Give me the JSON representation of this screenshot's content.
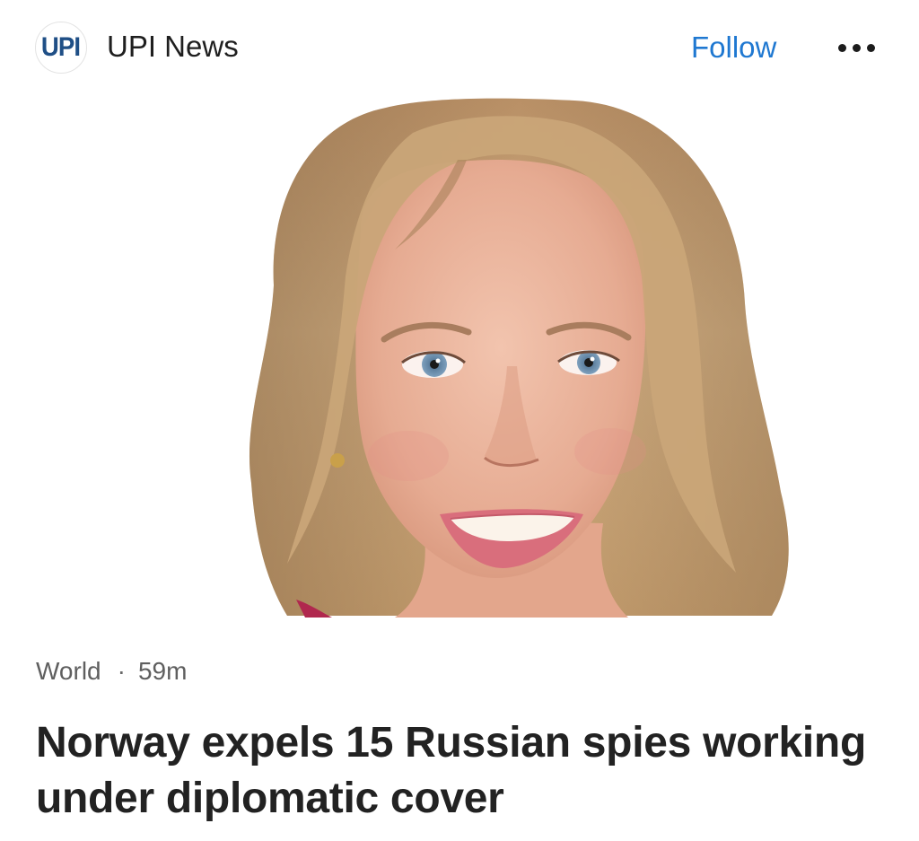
{
  "publisher": {
    "logo_text": "UPI",
    "name": "UPI News",
    "follow_label": "Follow",
    "more_icon": "more-horizontal-icon",
    "brand_color": "#1f4f86",
    "accent_color": "#1f78d1"
  },
  "article": {
    "category": "World",
    "separator": "·",
    "time_ago": "59m",
    "headline": "Norway expels 15 Russian spies working under diplomatic cover"
  }
}
